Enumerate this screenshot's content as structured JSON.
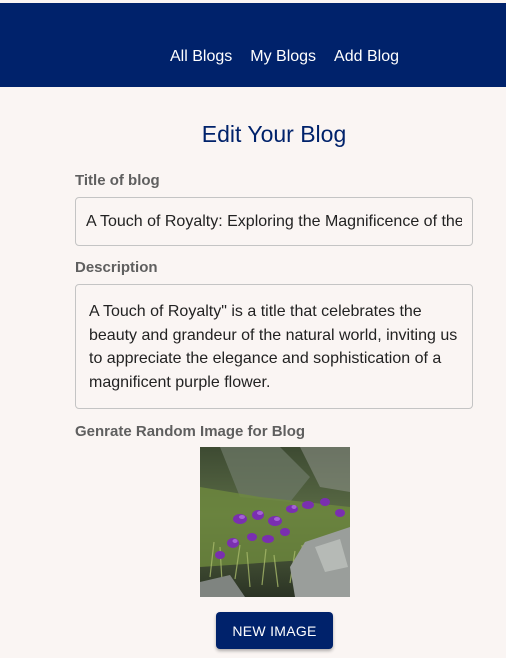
{
  "nav": {
    "all_blogs": "All Blogs",
    "my_blogs": "My Blogs",
    "add_blog": "Add Blog"
  },
  "page": {
    "title": "Edit Your Blog"
  },
  "form": {
    "title_label": "Title of blog",
    "title_value": "A Touch of Royalty: Exploring the Magnificence of the Purple Flower",
    "description_label": "Description",
    "description_value": "A Touch of Royalty\" is a title that celebrates the beauty and grandeur of the natural world, inviting us to appreciate the elegance and sophistication of a magnificent purple flower.",
    "image_label": "Genrate Random Image for Blog",
    "new_image_button": "NEW IMAGE"
  },
  "colors": {
    "navbar": "#00226b",
    "background": "#faf5f3",
    "accent": "#00226b"
  }
}
